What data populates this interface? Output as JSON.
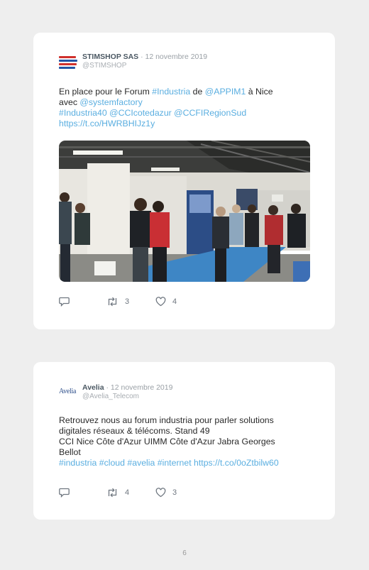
{
  "posts": [
    {
      "author": "STIMSHOP SAS",
      "date": "· 12 novembre 2019",
      "handle": "@STIMSHOP",
      "text": {
        "l1_a": "En place pour le Forum ",
        "l1_link1": "#Industria",
        "l1_b": " de ",
        "l1_link2": "@APPIM1",
        "l1_c": " à Nice",
        "l2_a": "avec ",
        "l2_link": "@systemfactory",
        "l3": "#Industria40 @CCIcotedazur @CCFIRegionSud",
        "l4": "https://t.co/HWRBHIJz1y"
      },
      "retweets": "3",
      "likes": "4"
    },
    {
      "author": "Avelia",
      "date": "· 12 novembre 2019",
      "handle": "@Avelia_Telecom",
      "logo": "Avelia",
      "text": {
        "l1": "Retrouvez nous au forum industria pour parler solutions",
        "l2": "digitales réseaux & télécoms. Stand 49",
        "l3": "CCI Nice Côte d'Azur UIMM Côte d'Azur Jabra Georges",
        "l4": "Bellot",
        "l5": "#industria #cloud #avelia #internet https://t.co/0oZtbilw60"
      },
      "retweets": "4",
      "likes": "3"
    }
  ],
  "page_number": "6"
}
